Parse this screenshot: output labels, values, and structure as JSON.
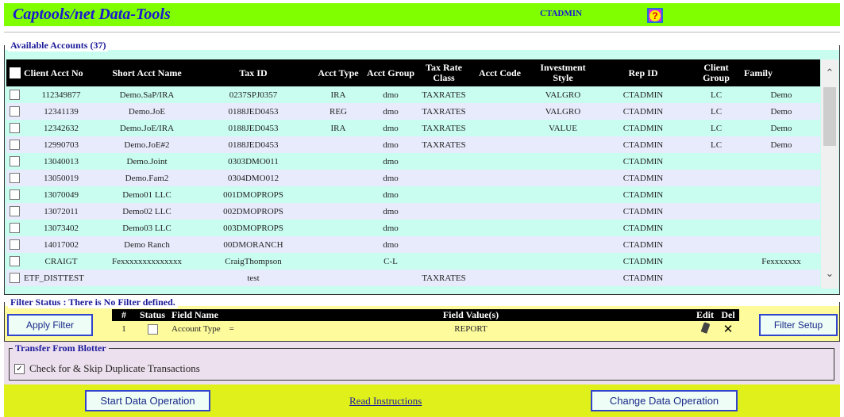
{
  "header": {
    "title": "Captools/net Data-Tools",
    "user": "CTADMIN",
    "help_icon": "help-question-icon"
  },
  "accounts": {
    "legend": "Available Accounts (37)",
    "columns": [
      "Client Acct No",
      "Short Acct Name",
      "Tax ID",
      "Acct Type",
      "Acct Group",
      "Tax Rate Class",
      "Acct Code",
      "Investment Style",
      "Rep ID",
      "Client Group",
      "Family"
    ],
    "rows": [
      {
        "acct_no": "112349877",
        "short_name": "Demo.SaP/IRA",
        "tax_id": "0237SPJ0357",
        "acct_type": "IRA",
        "acct_group": "dmo",
        "tax_rate_class": "TAXRATES",
        "acct_code": "",
        "investment_style": "VALGRO",
        "rep_id": "CTADMIN",
        "client_group": "LC",
        "family": "Demo"
      },
      {
        "acct_no": "12341139",
        "short_name": "Demo.JoE",
        "tax_id": "0188JED0453",
        "acct_type": "REG",
        "acct_group": "dmo",
        "tax_rate_class": "TAXRATES",
        "acct_code": "",
        "investment_style": "VALGRO",
        "rep_id": "CTADMIN",
        "client_group": "LC",
        "family": "Demo"
      },
      {
        "acct_no": "12342632",
        "short_name": "Demo.JoE/IRA",
        "tax_id": "0188JED0453",
        "acct_type": "IRA",
        "acct_group": "dmo",
        "tax_rate_class": "TAXRATES",
        "acct_code": "",
        "investment_style": "VALUE",
        "rep_id": "CTADMIN",
        "client_group": "LC",
        "family": "Demo"
      },
      {
        "acct_no": "12990703",
        "short_name": "Demo.JoE#2",
        "tax_id": "0188JED0453",
        "acct_type": "",
        "acct_group": "dmo",
        "tax_rate_class": "TAXRATES",
        "acct_code": "",
        "investment_style": "",
        "rep_id": "CTADMIN",
        "client_group": "LC",
        "family": "Demo"
      },
      {
        "acct_no": "13040013",
        "short_name": "Demo.Joint",
        "tax_id": "0303DMO011",
        "acct_type": "",
        "acct_group": "dmo",
        "tax_rate_class": "",
        "acct_code": "",
        "investment_style": "",
        "rep_id": "CTADMIN",
        "client_group": "",
        "family": ""
      },
      {
        "acct_no": "13050019",
        "short_name": "Demo.Fam2",
        "tax_id": "0304DMO012",
        "acct_type": "",
        "acct_group": "dmo",
        "tax_rate_class": "",
        "acct_code": "",
        "investment_style": "",
        "rep_id": "CTADMIN",
        "client_group": "",
        "family": ""
      },
      {
        "acct_no": "13070049",
        "short_name": "Demo01 LLC",
        "tax_id": "001DMOPROPS",
        "acct_type": "",
        "acct_group": "dmo",
        "tax_rate_class": "",
        "acct_code": "",
        "investment_style": "",
        "rep_id": "CTADMIN",
        "client_group": "",
        "family": ""
      },
      {
        "acct_no": "13072011",
        "short_name": "Demo02 LLC",
        "tax_id": "002DMOPROPS",
        "acct_type": "",
        "acct_group": "dmo",
        "tax_rate_class": "",
        "acct_code": "",
        "investment_style": "",
        "rep_id": "CTADMIN",
        "client_group": "",
        "family": ""
      },
      {
        "acct_no": "13073402",
        "short_name": "Demo03 LLC",
        "tax_id": "003DMOPROPS",
        "acct_type": "",
        "acct_group": "dmo",
        "tax_rate_class": "",
        "acct_code": "",
        "investment_style": "",
        "rep_id": "CTADMIN",
        "client_group": "",
        "family": ""
      },
      {
        "acct_no": "14017002",
        "short_name": "Demo Ranch",
        "tax_id": "00DMORANCH",
        "acct_type": "",
        "acct_group": "dmo",
        "tax_rate_class": "",
        "acct_code": "",
        "investment_style": "",
        "rep_id": "CTADMIN",
        "client_group": "",
        "family": ""
      },
      {
        "acct_no": "CRAIGT",
        "short_name": "Fexxxxxxxxxxxxxx",
        "tax_id": "CraigThompson",
        "acct_type": "",
        "acct_group": "C-L",
        "tax_rate_class": "",
        "acct_code": "",
        "investment_style": "",
        "rep_id": "CTADMIN",
        "client_group": "",
        "family": "Fexxxxxxx"
      },
      {
        "acct_no": "ETF_DISTTEST",
        "short_name": "",
        "tax_id": "test",
        "acct_type": "",
        "acct_group": "",
        "tax_rate_class": "TAXRATES",
        "acct_code": "",
        "investment_style": "",
        "rep_id": "CTADMIN",
        "client_group": "",
        "family": ""
      }
    ]
  },
  "filter": {
    "legend": "Filter Status : There is No Filter defined.",
    "apply_label": "Apply Filter",
    "setup_label": "Filter Setup",
    "columns": [
      "#",
      "Status",
      "Field Name",
      "Field Value(s)",
      "Edit",
      "Del"
    ],
    "rows": [
      {
        "num": "1",
        "field_name": "Account Type",
        "operator": "=",
        "value": "REPORT"
      }
    ]
  },
  "blotter": {
    "legend": "Transfer From Blotter",
    "skip_duplicates_label": "Check for & Skip Duplicate Transactions",
    "skip_duplicates_checked": true
  },
  "actions": {
    "start_label": "Start Data Operation",
    "instructions_label": "Read Instructions",
    "change_label": "Change Data Operation"
  },
  "colors": {
    "title_bar": "#80ff00",
    "title_text": "#1a1ad0",
    "row_odd": "#c8fdef",
    "row_even": "#e8ebfc",
    "filter_bg": "#fdfb9c",
    "blotter_bg": "#ede0ee",
    "action_bar": "#e0f01a"
  }
}
